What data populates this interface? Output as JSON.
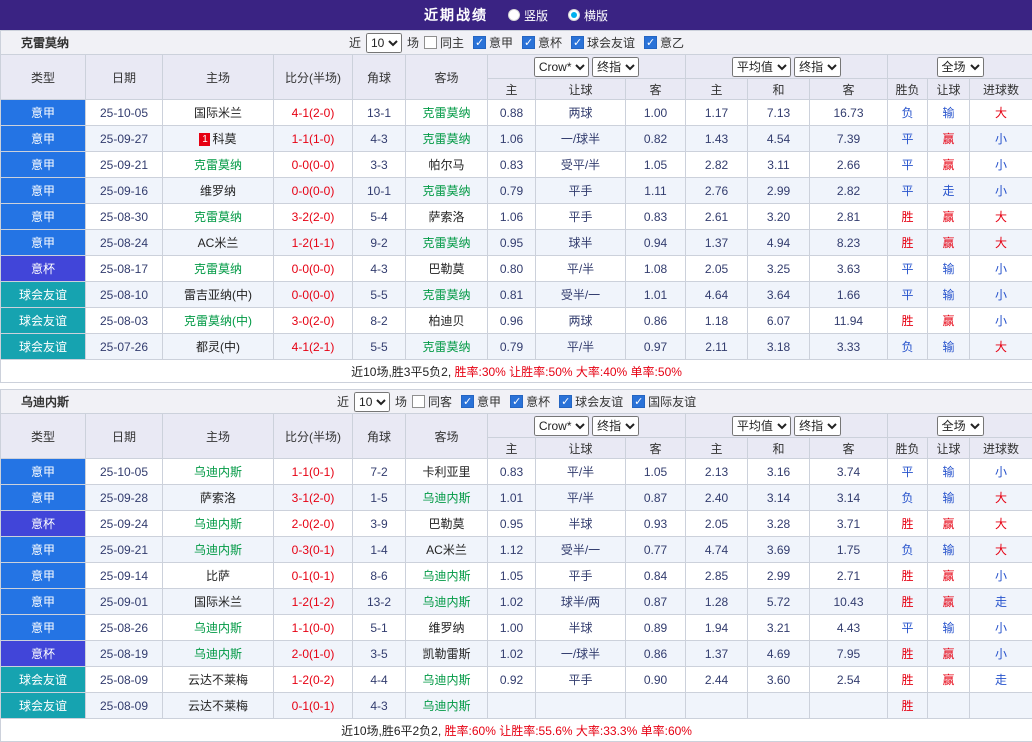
{
  "topbar": {
    "title": "近期战绩",
    "layout_options": [
      {
        "label": "竖版",
        "selected": false
      },
      {
        "label": "横版",
        "selected": true
      }
    ]
  },
  "colors": {
    "topbar_bg": "#3a2383",
    "serie_a_bg": "#2474e4",
    "cup_bg": "#4145d9",
    "friendly_bg": "#16a3b0",
    "featured_team_green": "#009944",
    "win_red": "#e60012",
    "lose_blue": "#2753cc",
    "score_red": "#e60012",
    "header_bg": "#e9e9f4",
    "alt_row_bg": "#f0f4fb",
    "radio_selected": "#00b0ef"
  },
  "sections": [
    {
      "team": "克雷莫纳",
      "filter": {
        "near_label": "近",
        "count_value": "10",
        "unit_label": "场",
        "checkboxes": [
          {
            "label": "同主",
            "checked": false
          },
          {
            "label": "意甲",
            "checked": true
          },
          {
            "label": "意杯",
            "checked": true
          },
          {
            "label": "球会友谊",
            "checked": true
          },
          {
            "label": "意乙",
            "checked": true
          }
        ]
      },
      "selectors": {
        "book": "Crow*",
        "book_mode": "终指",
        "avg": "平均值",
        "avg_mode": "终指",
        "scope": "全场"
      },
      "columns": [
        "类型",
        "日期",
        "主场",
        "比分(半场)",
        "角球",
        "客场",
        "主",
        "让球",
        "客",
        "主",
        "和",
        "客",
        "胜负",
        "让球",
        "进球数"
      ],
      "rows": [
        {
          "lg": "意甲",
          "lt": "l1",
          "date": "25-10-05",
          "home": "国际米兰",
          "hc": "k",
          "hb": "",
          "score": "4-1(2-0)",
          "corner": "13-1",
          "away": "克雷莫纳",
          "ac": "g",
          "odds": [
            "0.88",
            "两球",
            "1.00",
            "1.17",
            "7.13",
            "16.73"
          ],
          "res": "负",
          "resc": "b",
          "hr": "输",
          "hrc": "b",
          "gl": "大",
          "glc": "r"
        },
        {
          "lg": "意甲",
          "lt": "l1",
          "date": "25-09-27",
          "home": "科莫",
          "hc": "k",
          "hb": "1",
          "score": "1-1(1-0)",
          "corner": "4-3",
          "away": "克雷莫纳",
          "ac": "g",
          "odds": [
            "1.06",
            "一/球半",
            "0.82",
            "1.43",
            "4.54",
            "7.39"
          ],
          "res": "平",
          "resc": "b",
          "hr": "赢",
          "hrc": "r",
          "gl": "小",
          "glc": "b"
        },
        {
          "lg": "意甲",
          "lt": "l1",
          "date": "25-09-21",
          "home": "克雷莫纳",
          "hc": "g",
          "hb": "",
          "score": "0-0(0-0)",
          "corner": "3-3",
          "away": "帕尔马",
          "ac": "k",
          "odds": [
            "0.83",
            "受平/半",
            "1.05",
            "2.82",
            "3.11",
            "2.66"
          ],
          "res": "平",
          "resc": "b",
          "hr": "赢",
          "hrc": "r",
          "gl": "小",
          "glc": "b"
        },
        {
          "lg": "意甲",
          "lt": "l1",
          "date": "25-09-16",
          "home": "维罗纳",
          "hc": "k",
          "hb": "",
          "score": "0-0(0-0)",
          "corner": "10-1",
          "away": "克雷莫纳",
          "ac": "g",
          "odds": [
            "0.79",
            "平手",
            "1.11",
            "2.76",
            "2.99",
            "2.82"
          ],
          "res": "平",
          "resc": "b",
          "hr": "走",
          "hrc": "b",
          "gl": "小",
          "glc": "b"
        },
        {
          "lg": "意甲",
          "lt": "l1",
          "date": "25-08-30",
          "home": "克雷莫纳",
          "hc": "g",
          "hb": "",
          "score": "3-2(2-0)",
          "corner": "5-4",
          "away": "萨索洛",
          "ac": "k",
          "odds": [
            "1.06",
            "平手",
            "0.83",
            "2.61",
            "3.20",
            "2.81"
          ],
          "res": "胜",
          "resc": "r",
          "hr": "赢",
          "hrc": "r",
          "gl": "大",
          "glc": "r"
        },
        {
          "lg": "意甲",
          "lt": "l1",
          "date": "25-08-24",
          "home": "AC米兰",
          "hc": "k",
          "hb": "",
          "score": "1-2(1-1)",
          "corner": "9-2",
          "away": "克雷莫纳",
          "ac": "g",
          "odds": [
            "0.95",
            "球半",
            "0.94",
            "1.37",
            "4.94",
            "8.23"
          ],
          "res": "胜",
          "resc": "r",
          "hr": "赢",
          "hrc": "r",
          "gl": "大",
          "glc": "r"
        },
        {
          "lg": "意杯",
          "lt": "cup",
          "date": "25-08-17",
          "home": "克雷莫纳",
          "hc": "g",
          "hb": "",
          "score": "0-0(0-0)",
          "corner": "4-3",
          "away": "巴勒莫",
          "ac": "k",
          "odds": [
            "0.80",
            "平/半",
            "1.08",
            "2.05",
            "3.25",
            "3.63"
          ],
          "res": "平",
          "resc": "b",
          "hr": "输",
          "hrc": "b",
          "gl": "小",
          "glc": "b"
        },
        {
          "lg": "球会友谊",
          "lt": "fr",
          "date": "25-08-10",
          "home": "雷吉亚纳(中)",
          "hc": "k",
          "hb": "",
          "score": "0-0(0-0)",
          "corner": "5-5",
          "away": "克雷莫纳",
          "ac": "g",
          "odds": [
            "0.81",
            "受半/一",
            "1.01",
            "4.64",
            "3.64",
            "1.66"
          ],
          "res": "平",
          "resc": "b",
          "hr": "输",
          "hrc": "b",
          "gl": "小",
          "glc": "b"
        },
        {
          "lg": "球会友谊",
          "lt": "fr",
          "date": "25-08-03",
          "home": "克雷莫纳(中)",
          "hc": "g",
          "hb": "",
          "score": "3-0(2-0)",
          "corner": "8-2",
          "away": "柏迪贝",
          "ac": "k",
          "odds": [
            "0.96",
            "两球",
            "0.86",
            "1.18",
            "6.07",
            "11.94"
          ],
          "res": "胜",
          "resc": "r",
          "hr": "赢",
          "hrc": "r",
          "gl": "小",
          "glc": "b"
        },
        {
          "lg": "球会友谊",
          "lt": "fr",
          "date": "25-07-26",
          "home": "都灵(中)",
          "hc": "k",
          "hb": "",
          "score": "4-1(2-1)",
          "corner": "5-5",
          "away": "克雷莫纳",
          "ac": "g",
          "odds": [
            "0.79",
            "平/半",
            "0.97",
            "2.11",
            "3.18",
            "3.33"
          ],
          "res": "负",
          "resc": "b",
          "hr": "输",
          "hrc": "b",
          "gl": "大",
          "glc": "r"
        }
      ],
      "summary": {
        "record": "近10场,胜3平5负2,",
        "rates": "胜率:30% 让胜率:50% 大率:40% 单率:50%"
      }
    },
    {
      "team": "乌迪内斯",
      "filter": {
        "near_label": "近",
        "count_value": "10",
        "unit_label": "场",
        "checkboxes": [
          {
            "label": "同客",
            "checked": false
          },
          {
            "label": "意甲",
            "checked": true
          },
          {
            "label": "意杯",
            "checked": true
          },
          {
            "label": "球会友谊",
            "checked": true
          },
          {
            "label": "国际友谊",
            "checked": true
          }
        ]
      },
      "selectors": {
        "book": "Crow*",
        "book_mode": "终指",
        "avg": "平均值",
        "avg_mode": "终指",
        "scope": "全场"
      },
      "columns": [
        "类型",
        "日期",
        "主场",
        "比分(半场)",
        "角球",
        "客场",
        "主",
        "让球",
        "客",
        "主",
        "和",
        "客",
        "胜负",
        "让球",
        "进球数"
      ],
      "rows": [
        {
          "lg": "意甲",
          "lt": "l1",
          "date": "25-10-05",
          "home": "乌迪内斯",
          "hc": "g",
          "hb": "",
          "score": "1-1(0-1)",
          "corner": "7-2",
          "away": "卡利亚里",
          "ac": "k",
          "odds": [
            "0.83",
            "平/半",
            "1.05",
            "2.13",
            "3.16",
            "3.74"
          ],
          "res": "平",
          "resc": "b",
          "hr": "输",
          "hrc": "b",
          "gl": "小",
          "glc": "b"
        },
        {
          "lg": "意甲",
          "lt": "l1",
          "date": "25-09-28",
          "home": "萨索洛",
          "hc": "k",
          "hb": "",
          "score": "3-1(2-0)",
          "corner": "1-5",
          "away": "乌迪内斯",
          "ac": "g",
          "odds": [
            "1.01",
            "平/半",
            "0.87",
            "2.40",
            "3.14",
            "3.14"
          ],
          "res": "负",
          "resc": "b",
          "hr": "输",
          "hrc": "b",
          "gl": "大",
          "glc": "r"
        },
        {
          "lg": "意杯",
          "lt": "cup",
          "date": "25-09-24",
          "home": "乌迪内斯",
          "hc": "g",
          "hb": "",
          "score": "2-0(2-0)",
          "corner": "3-9",
          "away": "巴勒莫",
          "ac": "k",
          "odds": [
            "0.95",
            "半球",
            "0.93",
            "2.05",
            "3.28",
            "3.71"
          ],
          "res": "胜",
          "resc": "r",
          "hr": "赢",
          "hrc": "r",
          "gl": "大",
          "glc": "r"
        },
        {
          "lg": "意甲",
          "lt": "l1",
          "date": "25-09-21",
          "home": "乌迪内斯",
          "hc": "g",
          "hb": "",
          "score": "0-3(0-1)",
          "corner": "1-4",
          "away": "AC米兰",
          "ac": "k",
          "odds": [
            "1.12",
            "受半/一",
            "0.77",
            "4.74",
            "3.69",
            "1.75"
          ],
          "res": "负",
          "resc": "b",
          "hr": "输",
          "hrc": "b",
          "gl": "大",
          "glc": "r"
        },
        {
          "lg": "意甲",
          "lt": "l1",
          "date": "25-09-14",
          "home": "比萨",
          "hc": "k",
          "hb": "",
          "score": "0-1(0-1)",
          "corner": "8-6",
          "away": "乌迪内斯",
          "ac": "g",
          "odds": [
            "1.05",
            "平手",
            "0.84",
            "2.85",
            "2.99",
            "2.71"
          ],
          "res": "胜",
          "resc": "r",
          "hr": "赢",
          "hrc": "r",
          "gl": "小",
          "glc": "b"
        },
        {
          "lg": "意甲",
          "lt": "l1",
          "date": "25-09-01",
          "home": "国际米兰",
          "hc": "k",
          "hb": "",
          "score": "1-2(1-2)",
          "corner": "13-2",
          "away": "乌迪内斯",
          "ac": "g",
          "odds": [
            "1.02",
            "球半/两",
            "0.87",
            "1.28",
            "5.72",
            "10.43"
          ],
          "res": "胜",
          "resc": "r",
          "hr": "赢",
          "hrc": "r",
          "gl": "走",
          "glc": "b"
        },
        {
          "lg": "意甲",
          "lt": "l1",
          "date": "25-08-26",
          "home": "乌迪内斯",
          "hc": "g",
          "hb": "",
          "score": "1-1(0-0)",
          "corner": "5-1",
          "away": "维罗纳",
          "ac": "k",
          "odds": [
            "1.00",
            "半球",
            "0.89",
            "1.94",
            "3.21",
            "4.43"
          ],
          "res": "平",
          "resc": "b",
          "hr": "输",
          "hrc": "b",
          "gl": "小",
          "glc": "b"
        },
        {
          "lg": "意杯",
          "lt": "cup",
          "date": "25-08-19",
          "home": "乌迪内斯",
          "hc": "g",
          "hb": "",
          "score": "2-0(1-0)",
          "corner": "3-5",
          "away": "凯勒雷斯",
          "ac": "k",
          "odds": [
            "1.02",
            "一/球半",
            "0.86",
            "1.37",
            "4.69",
            "7.95"
          ],
          "res": "胜",
          "resc": "r",
          "hr": "赢",
          "hrc": "r",
          "gl": "小",
          "glc": "b"
        },
        {
          "lg": "球会友谊",
          "lt": "fr",
          "date": "25-08-09",
          "home": "云达不莱梅",
          "hc": "k",
          "hb": "",
          "score": "1-2(0-2)",
          "corner": "4-4",
          "away": "乌迪内斯",
          "ac": "g",
          "odds": [
            "0.92",
            "平手",
            "0.90",
            "2.44",
            "3.60",
            "2.54"
          ],
          "res": "胜",
          "resc": "r",
          "hr": "赢",
          "hrc": "r",
          "gl": "走",
          "glc": "b"
        },
        {
          "lg": "球会友谊",
          "lt": "fr",
          "date": "25-08-09",
          "home": "云达不莱梅",
          "hc": "k",
          "hb": "",
          "score": "0-1(0-1)",
          "corner": "4-3",
          "away": "乌迪内斯",
          "ac": "g",
          "odds": [
            "",
            "",
            "",
            "",
            "",
            ""
          ],
          "res": "胜",
          "resc": "r",
          "hr": "",
          "hrc": "b",
          "gl": "",
          "glc": "b"
        }
      ],
      "summary": {
        "record": "近10场,胜6平2负2,",
        "rates": "胜率:60% 让胜率:55.6% 大率:33.3% 单率:60%"
      }
    }
  ]
}
